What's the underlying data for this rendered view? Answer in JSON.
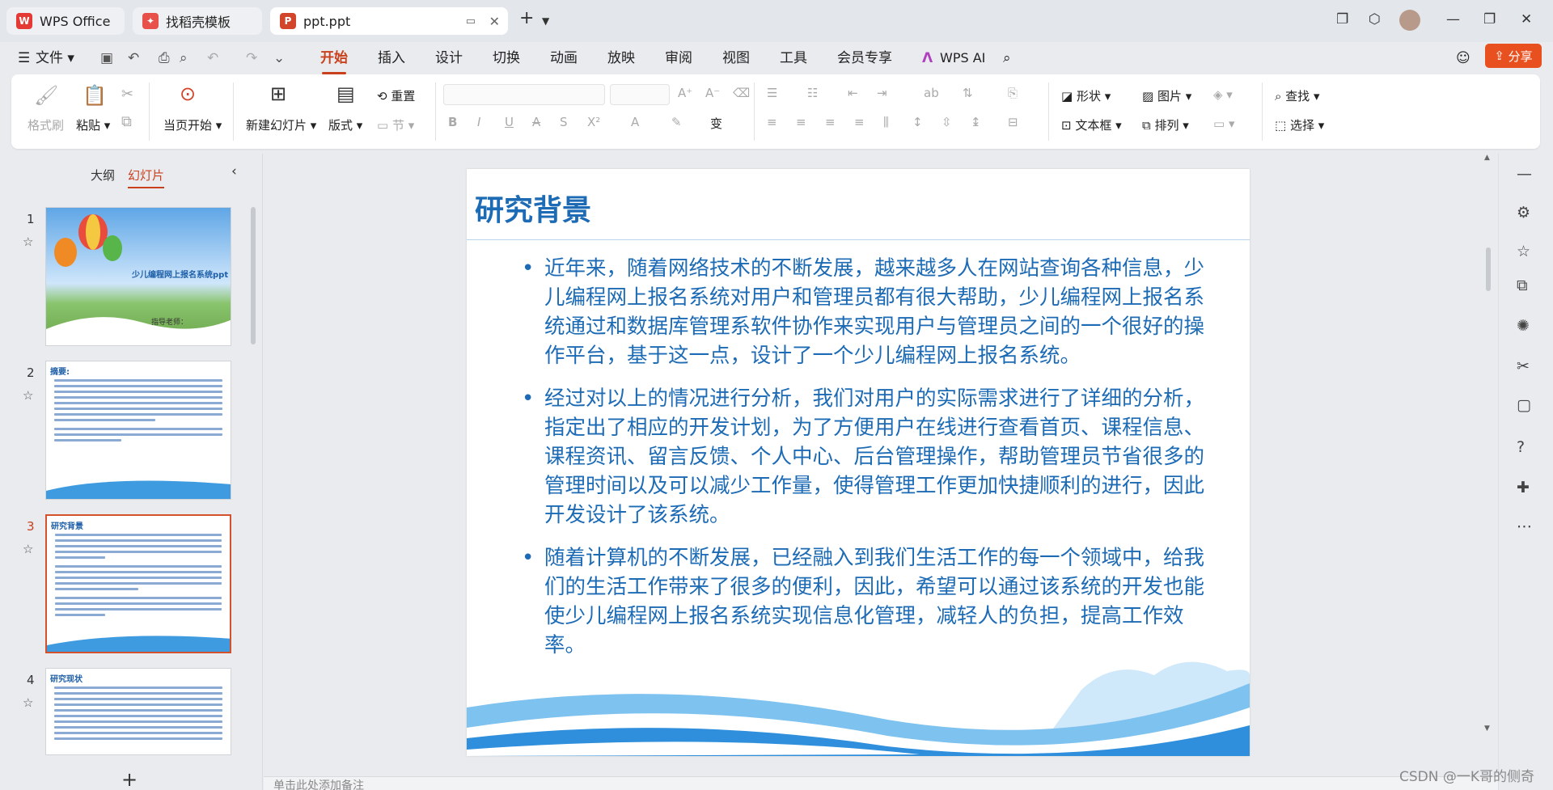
{
  "tabs": [
    {
      "label": "WPS Office",
      "logo": "W"
    },
    {
      "label": "找稻壳模板",
      "logo": "✦"
    },
    {
      "label": "ppt.ppt",
      "logo": "P"
    }
  ],
  "menu": {
    "file": "文件",
    "items": [
      "开始",
      "插入",
      "设计",
      "切换",
      "动画",
      "放映",
      "审阅",
      "视图",
      "工具",
      "会员专享"
    ],
    "wps_ai": "WPS AI",
    "share": "分享"
  },
  "ribbon": {
    "format_painter": "格式刷",
    "paste": "粘贴",
    "from_current": "当页开始",
    "new_slide": "新建幻灯片",
    "layout": "版式",
    "reset": "重置",
    "section": "节",
    "shape": "形状",
    "image": "图片",
    "textbox": "文本框",
    "arrange": "排列",
    "find": "查找",
    "select": "选择"
  },
  "left_panel": {
    "tab_outline": "大纲",
    "tab_slides": "幻灯片",
    "slides": [
      {
        "num": "1",
        "title": "少儿编程网上报名系统ppt",
        "subtitle": "指导老师："
      },
      {
        "num": "2",
        "title": "摘要:"
      },
      {
        "num": "3",
        "title": "研究背景"
      },
      {
        "num": "4",
        "title": "研究现状"
      }
    ]
  },
  "slide": {
    "title": "研究背景",
    "bullets": [
      "近年来，随着网络技术的不断发展，越来越多人在网站查询各种信息，少儿编程网上报名系统对用户和管理员都有很大帮助，少儿编程网上报名系统通过和数据库管理系软件协作来实现用户与管理员之间的一个很好的操作平台，基于这一点，设计了一个少儿编程网上报名系统。",
      "经过对以上的情况进行分析，我们对用户的实际需求进行了详细的分析，指定出了相应的开发计划，为了方便用户在线进行查看首页、课程信息、课程资讯、留言反馈、个人中心、后台管理操作，帮助管理员节省很多的管理时间以及可以减少工作量，使得管理工作更加快捷顺利的进行，因此开发设计了该系统。",
      "随着计算机的不断发展，已经融入到我们生活工作的每一个领域中，给我们的生活工作带来了很多的便利，因此，希望可以通过该系统的开发也能使少儿编程网上报名系统实现信息化管理，减轻人的负担，提高工作效率。"
    ]
  },
  "notes_placeholder": "单击此处添加备注",
  "watermark": "CSDN @一K哥的侧奇",
  "colors": {
    "accent": "#c9401d",
    "slide_blue": "#1d6bb5",
    "share": "#e8501f"
  }
}
